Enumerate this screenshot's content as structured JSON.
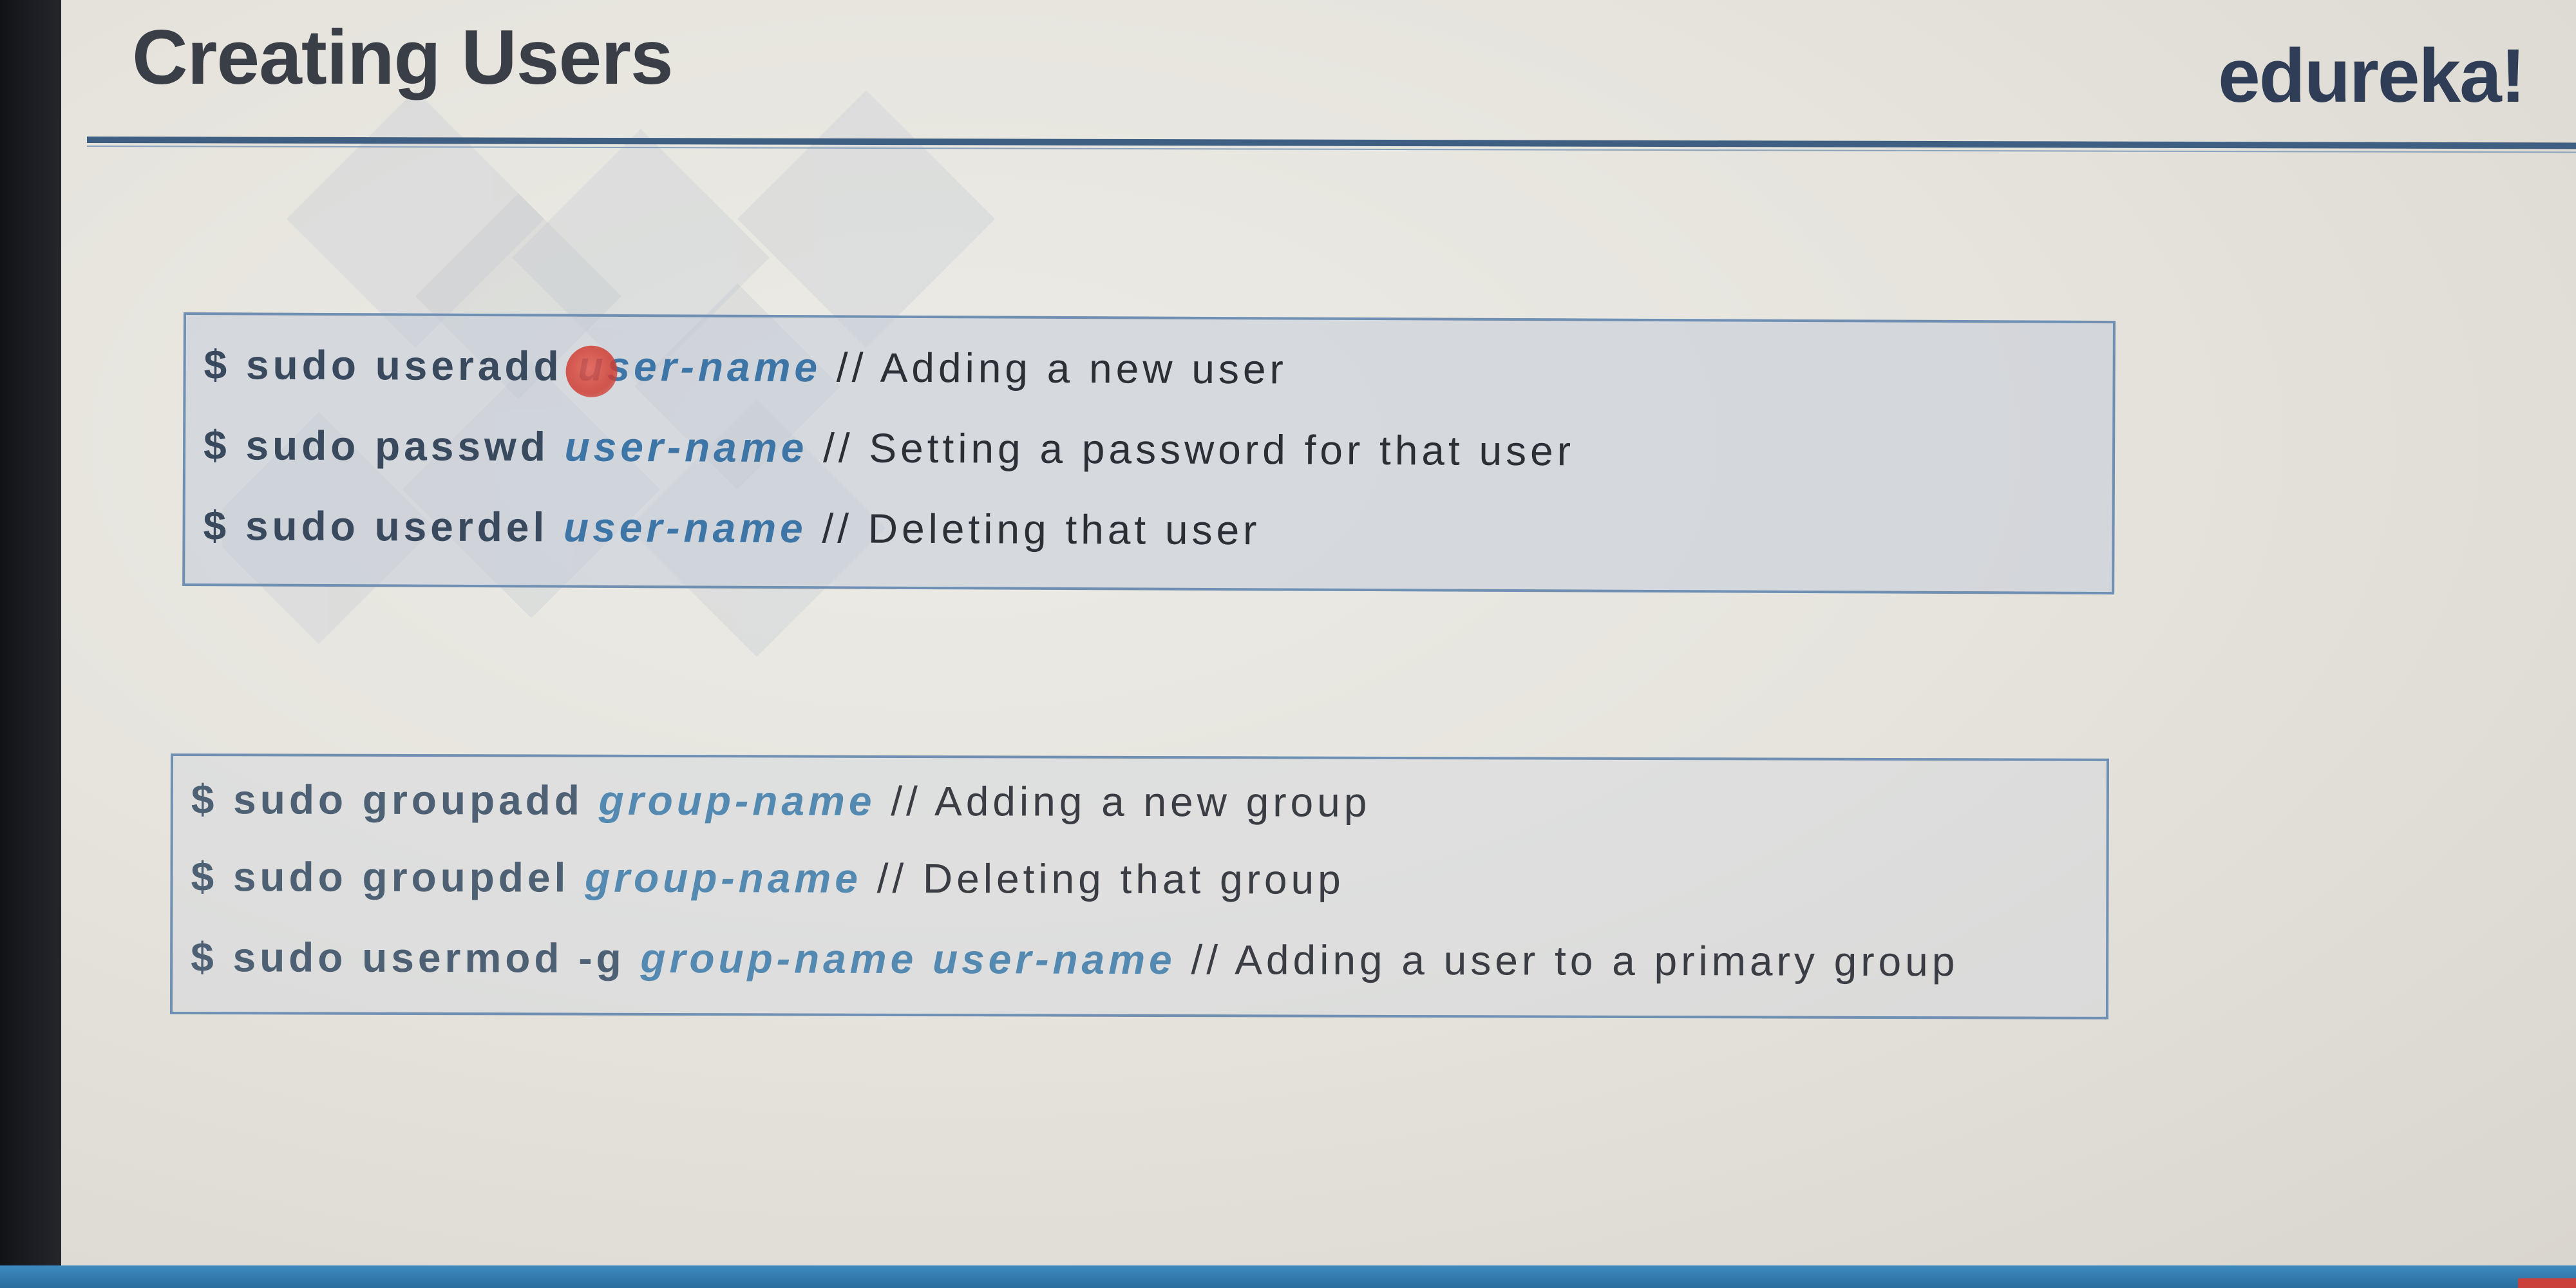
{
  "slide": {
    "title": "Creating Users",
    "brand": "edureka!"
  },
  "user_commands": [
    {
      "prompt": "$",
      "command": "sudo useradd",
      "argument": "user-name",
      "comment": "// Adding a new user"
    },
    {
      "prompt": "$",
      "command": "sudo passwd",
      "argument": "user-name",
      "comment": "// Setting a password for that user"
    },
    {
      "prompt": "$",
      "command": "sudo userdel",
      "argument": "user-name",
      "comment": "// Deleting that user"
    }
  ],
  "group_commands": [
    {
      "prompt": "$",
      "command": "sudo groupadd",
      "argument": "group-name",
      "comment": "// Adding a new group"
    },
    {
      "prompt": "$",
      "command": "sudo groupdel",
      "argument": "group-name",
      "comment": "// Deleting that group"
    },
    {
      "prompt": "$",
      "command": "sudo usermod -g",
      "argument": "group-name user-name",
      "comment": "// Adding a user to a primary group"
    }
  ],
  "colors": {
    "title": "#3a3f47",
    "brand": "#2f3e56",
    "header_rule": "#3e5f82",
    "box_border": "#6f8fb3",
    "argument_text": "#3d76a6",
    "cursor_highlight": "#d9473c",
    "bottom_bar": "#3d8ac1"
  },
  "icons": {
    "cursor": "pointer-highlight-dot"
  }
}
